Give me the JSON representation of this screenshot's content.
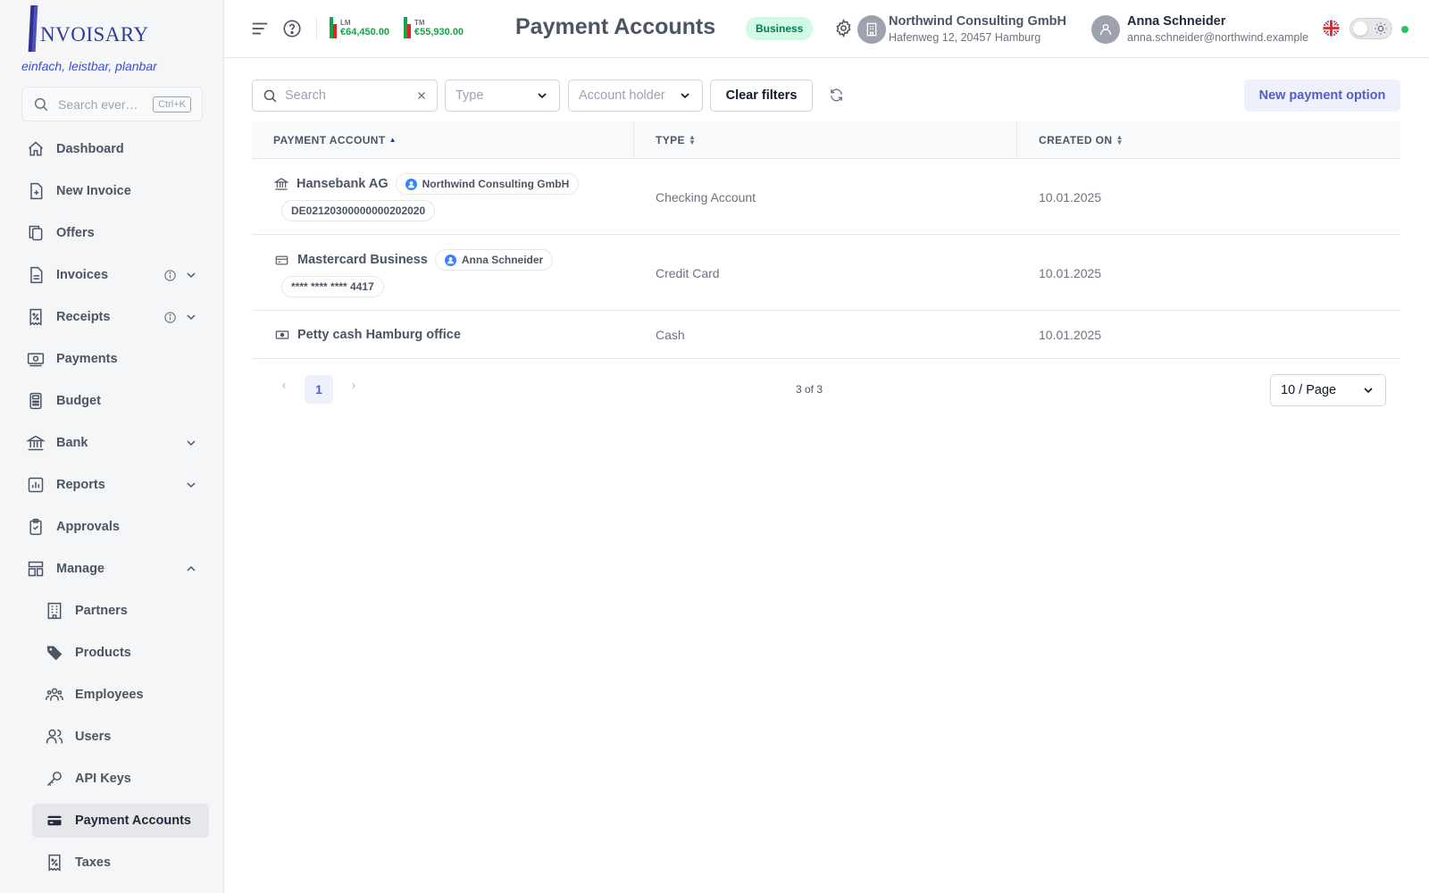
{
  "brand": {
    "logo_text": "NVOISARY",
    "tagline": "einfach, leistbar, planbar"
  },
  "sidebar": {
    "search_placeholder": "Search ever…",
    "search_shortcut": "Ctrl+K",
    "items": [
      {
        "label": "Dashboard",
        "icon": "home-icon"
      },
      {
        "label": "New Invoice",
        "icon": "file-plus-icon"
      },
      {
        "label": "Offers",
        "icon": "copy-icon"
      },
      {
        "label": "Invoices",
        "icon": "document-icon"
      },
      {
        "label": "Receipts",
        "icon": "receipt-icon"
      },
      {
        "label": "Payments",
        "icon": "cash-icon"
      },
      {
        "label": "Budget",
        "icon": "calculator-icon"
      },
      {
        "label": "Bank",
        "icon": "bank-icon"
      },
      {
        "label": "Reports",
        "icon": "chart-icon"
      },
      {
        "label": "Approvals",
        "icon": "clipboard-check-icon"
      },
      {
        "label": "Manage",
        "icon": "layout-icon"
      },
      {
        "label": "Partners",
        "icon": "building-icon"
      },
      {
        "label": "Products",
        "icon": "tag-icon"
      },
      {
        "label": "Employees",
        "icon": "users-group-icon"
      },
      {
        "label": "Users",
        "icon": "users-icon"
      },
      {
        "label": "API Keys",
        "icon": "key-icon"
      },
      {
        "label": "Payment Accounts",
        "icon": "credit-card-icon"
      },
      {
        "label": "Taxes",
        "icon": "receipt-percent-icon"
      }
    ]
  },
  "topbar": {
    "kpi_lm_label": "LM",
    "kpi_lm_value": "€64,450.00",
    "kpi_tm_label": "TM",
    "kpi_tm_value": "€55,930.00",
    "page_title": "Payment Accounts",
    "plan_badge": "Business",
    "org_name": "Northwind Consulting GmbH",
    "org_address": "Hafenweg 12, 20457 Hamburg",
    "user_name": "Anna Schneider",
    "user_email": "anna.schneider@northwind.example"
  },
  "filters": {
    "search_placeholder": "Search",
    "type_placeholder": "Type",
    "holder_placeholder": "Account holder",
    "clear_label": "Clear filters",
    "new_label": "New payment option"
  },
  "table": {
    "columns": [
      "PAYMENT ACCOUNT",
      "TYPE",
      "CREATED ON"
    ],
    "rows": [
      {
        "name": "Hansebank AG",
        "holder": "Northwind Consulting GmbH",
        "detail": "DE02120300000000202020",
        "type": "Checking Account",
        "created": "10.01.2025"
      },
      {
        "name": "Mastercard Business",
        "holder": "Anna Schneider",
        "detail": "**** **** **** 4417",
        "type": "Credit Card",
        "created": "10.01.2025"
      },
      {
        "name": "Petty cash Hamburg office",
        "type": "Cash",
        "created": "10.01.2025"
      }
    ]
  },
  "pagination": {
    "current": "1",
    "count": "3 of 3",
    "per_page": "10 / Page"
  },
  "colors": {
    "accent": "#4f5fc9",
    "success": "#16a34a",
    "danger": "#dc2626"
  }
}
